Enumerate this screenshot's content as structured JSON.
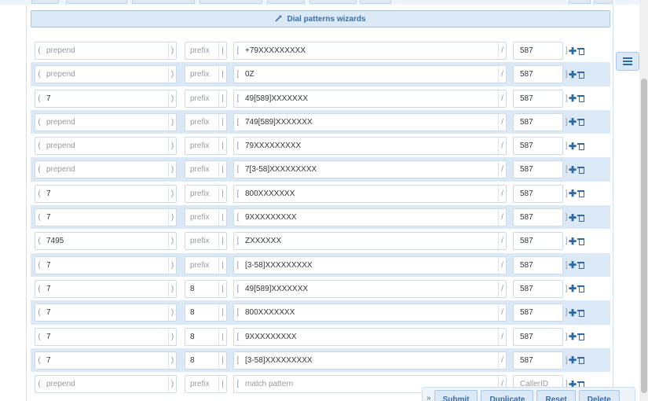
{
  "wizard": {
    "label": "Dial patterns wizards",
    "icon": "magic-wand-icon"
  },
  "brackets": {
    "open_paren": "(",
    "close_paren": ")",
    "pipe": "|",
    "open_square": "[",
    "slash": "/",
    "close_square": "]"
  },
  "rows": [
    {
      "prepend": "",
      "prefix": "",
      "match": "+79XXXXXXXXX",
      "callerid": "587"
    },
    {
      "prepend": "",
      "prefix": "",
      "match": "0Z",
      "callerid": "587"
    },
    {
      "prepend": "7",
      "prefix": "",
      "match": "49[589]XXXXXXX",
      "callerid": "587"
    },
    {
      "prepend": "",
      "prefix": "",
      "match": "749[589]XXXXXXX",
      "callerid": "587"
    },
    {
      "prepend": "",
      "prefix": "",
      "match": "79XXXXXXXXX",
      "callerid": "587"
    },
    {
      "prepend": "",
      "prefix": "",
      "match": "7[3-58]XXXXXXXXX",
      "callerid": "587"
    },
    {
      "prepend": "7",
      "prefix": "",
      "match": "800XXXXXXX",
      "callerid": "587"
    },
    {
      "prepend": "7",
      "prefix": "",
      "match": "9XXXXXXXXX",
      "callerid": "587"
    },
    {
      "prepend": "7495",
      "prefix": "",
      "match": "ZXXXXXX",
      "callerid": "587"
    },
    {
      "prepend": "7",
      "prefix": "",
      "match": "[3-58]XXXXXXXXX",
      "callerid": "587"
    },
    {
      "prepend": "7",
      "prefix": "8",
      "match": "49[589]XXXXXXX",
      "callerid": "587"
    },
    {
      "prepend": "7",
      "prefix": "8",
      "match": "800XXXXXXX",
      "callerid": "587"
    },
    {
      "prepend": "7",
      "prefix": "8",
      "match": "9XXXXXXXXX",
      "callerid": "587"
    },
    {
      "prepend": "7",
      "prefix": "8",
      "match": "[3-58]XXXXXXXXX",
      "callerid": "587"
    },
    {
      "prepend": "",
      "prefix": "",
      "match": "",
      "callerid": ""
    }
  ],
  "placeholders": {
    "prepend": "prepend",
    "prefix": "prefix",
    "match": "match pattern",
    "callerid": "CallerID"
  },
  "actions": {
    "add_icon": "plus-icon",
    "delete_icon": "trash-icon",
    "plus_glyph": "✚"
  },
  "side_toggle": {
    "icon": "list-icon"
  },
  "bottom_bar": {
    "chevron": "»",
    "buttons": [
      "Submit",
      "Duplicate",
      "Reset",
      "Delete"
    ]
  },
  "colors": {
    "accent": "#3a6fa6",
    "row_highlight": "#dbe9f6",
    "button_border": "#a9c7e3"
  }
}
